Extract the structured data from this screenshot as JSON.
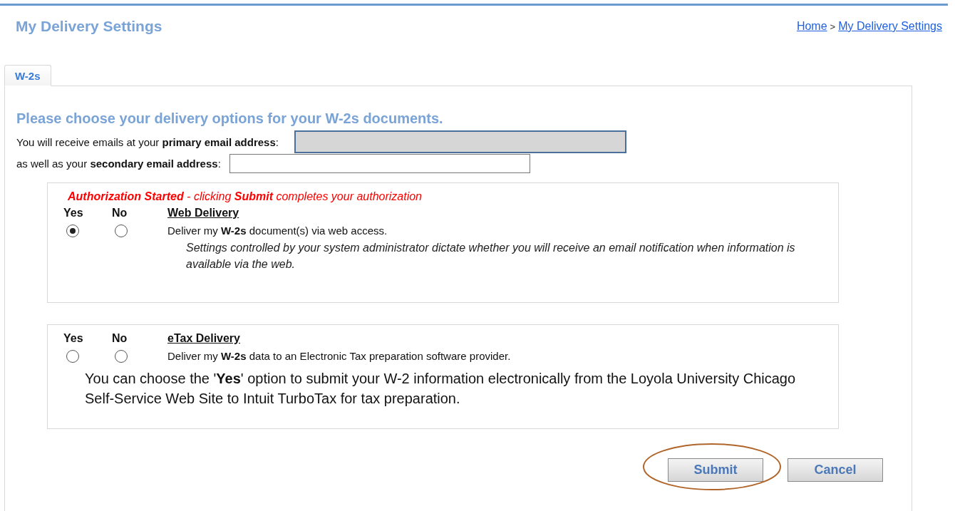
{
  "page_title": "My Delivery Settings",
  "breadcrumb": [
    {
      "label": "Home"
    },
    {
      "label": "My Delivery Settings"
    }
  ],
  "breadcrumb_separator": ">",
  "tabs": [
    {
      "label": "W-2s",
      "selected": true
    }
  ],
  "heading": "Please choose your delivery options for your W-2s documents.",
  "email_fields": [
    {
      "label": "You will receive emails at your **primary email address**:",
      "disabled": true
    },
    {
      "label": "as well as your **secondary email address**:",
      "disabled": false
    }
  ],
  "sections": [
    {
      "notice": "**Authorization Started** - clicking **Submit** completes your authorization",
      "title": "Web Delivery",
      "options": [
        {
          "label": "Yes",
          "selected": true
        },
        {
          "label": "No",
          "selected": false
        }
      ],
      "description": "Deliver my **W-2s** document(s) via web access.",
      "detail": "Settings controlled by your system administrator dictate whether you will receive an email notification when information is available via the web."
    },
    {
      "title": "eTax Delivery",
      "options": [
        {
          "label": "Yes",
          "selected": false
        },
        {
          "label": "No",
          "selected": false
        }
      ],
      "description": "Deliver my **W-2s** data to an Electronic Tax preparation software provider.",
      "note": "You can choose the '**Yes**' option to submit your W-2 information electronically from the Loyola University Chicago Self-Service Web Site to Intuit TurboTax for tax preparation."
    }
  ],
  "buttons": [
    {
      "label": "Submit",
      "highlighted": true
    },
    {
      "label": "Cancel",
      "highlighted": false
    }
  ]
}
